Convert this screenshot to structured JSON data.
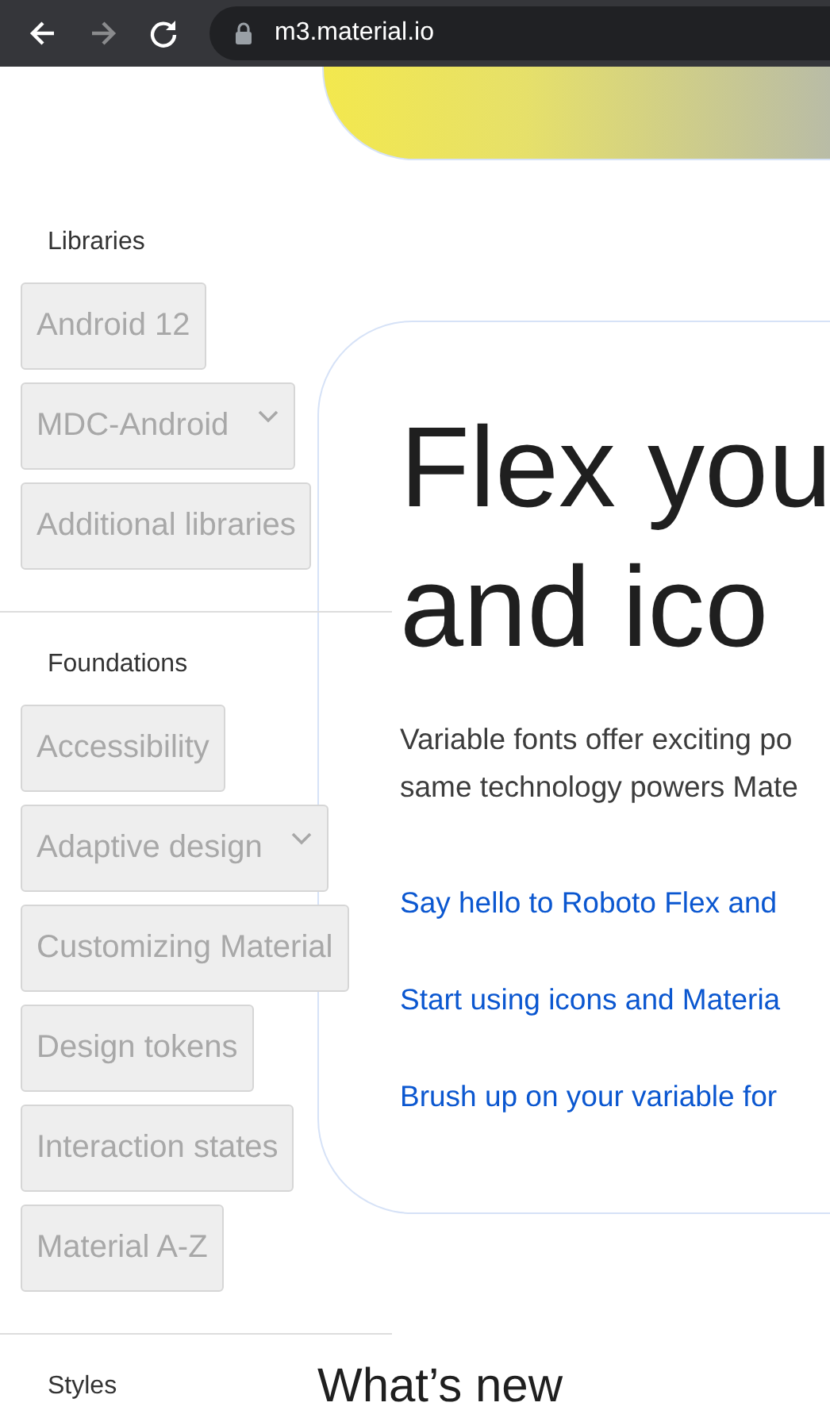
{
  "browser": {
    "nav": [
      {
        "kind": "back",
        "disabled": false
      },
      {
        "kind": "forward",
        "disabled": true
      },
      {
        "kind": "reload",
        "disabled": false
      }
    ],
    "url": "m3.material.io"
  },
  "sidebar": {
    "sections": [
      {
        "title": "Libraries",
        "items": [
          {
            "label": "Android 12",
            "expandable": false
          },
          {
            "label": "MDC-Android",
            "expandable": true
          },
          {
            "label": "Additional libraries",
            "expandable": false
          }
        ]
      },
      {
        "title": "Foundations",
        "items": [
          {
            "label": "Accessibility",
            "expandable": false
          },
          {
            "label": "Adaptive design",
            "expandable": true
          },
          {
            "label": "Customizing Material",
            "expandable": false
          },
          {
            "label": "Design tokens",
            "expandable": false
          },
          {
            "label": "Interaction states",
            "expandable": false
          },
          {
            "label": "Material A-Z",
            "expandable": false
          }
        ]
      },
      {
        "title": "Styles"
      }
    ]
  },
  "hero": {
    "title_lines": [
      "Flex you",
      "and ico"
    ],
    "body_lines": [
      "Variable fonts offer exciting po",
      "same technology powers Mate"
    ],
    "links": [
      "Say hello to Roboto Flex and",
      "Start using icons and Materia",
      "Brush up on your variable for"
    ]
  },
  "next_heading": "What’s new"
}
